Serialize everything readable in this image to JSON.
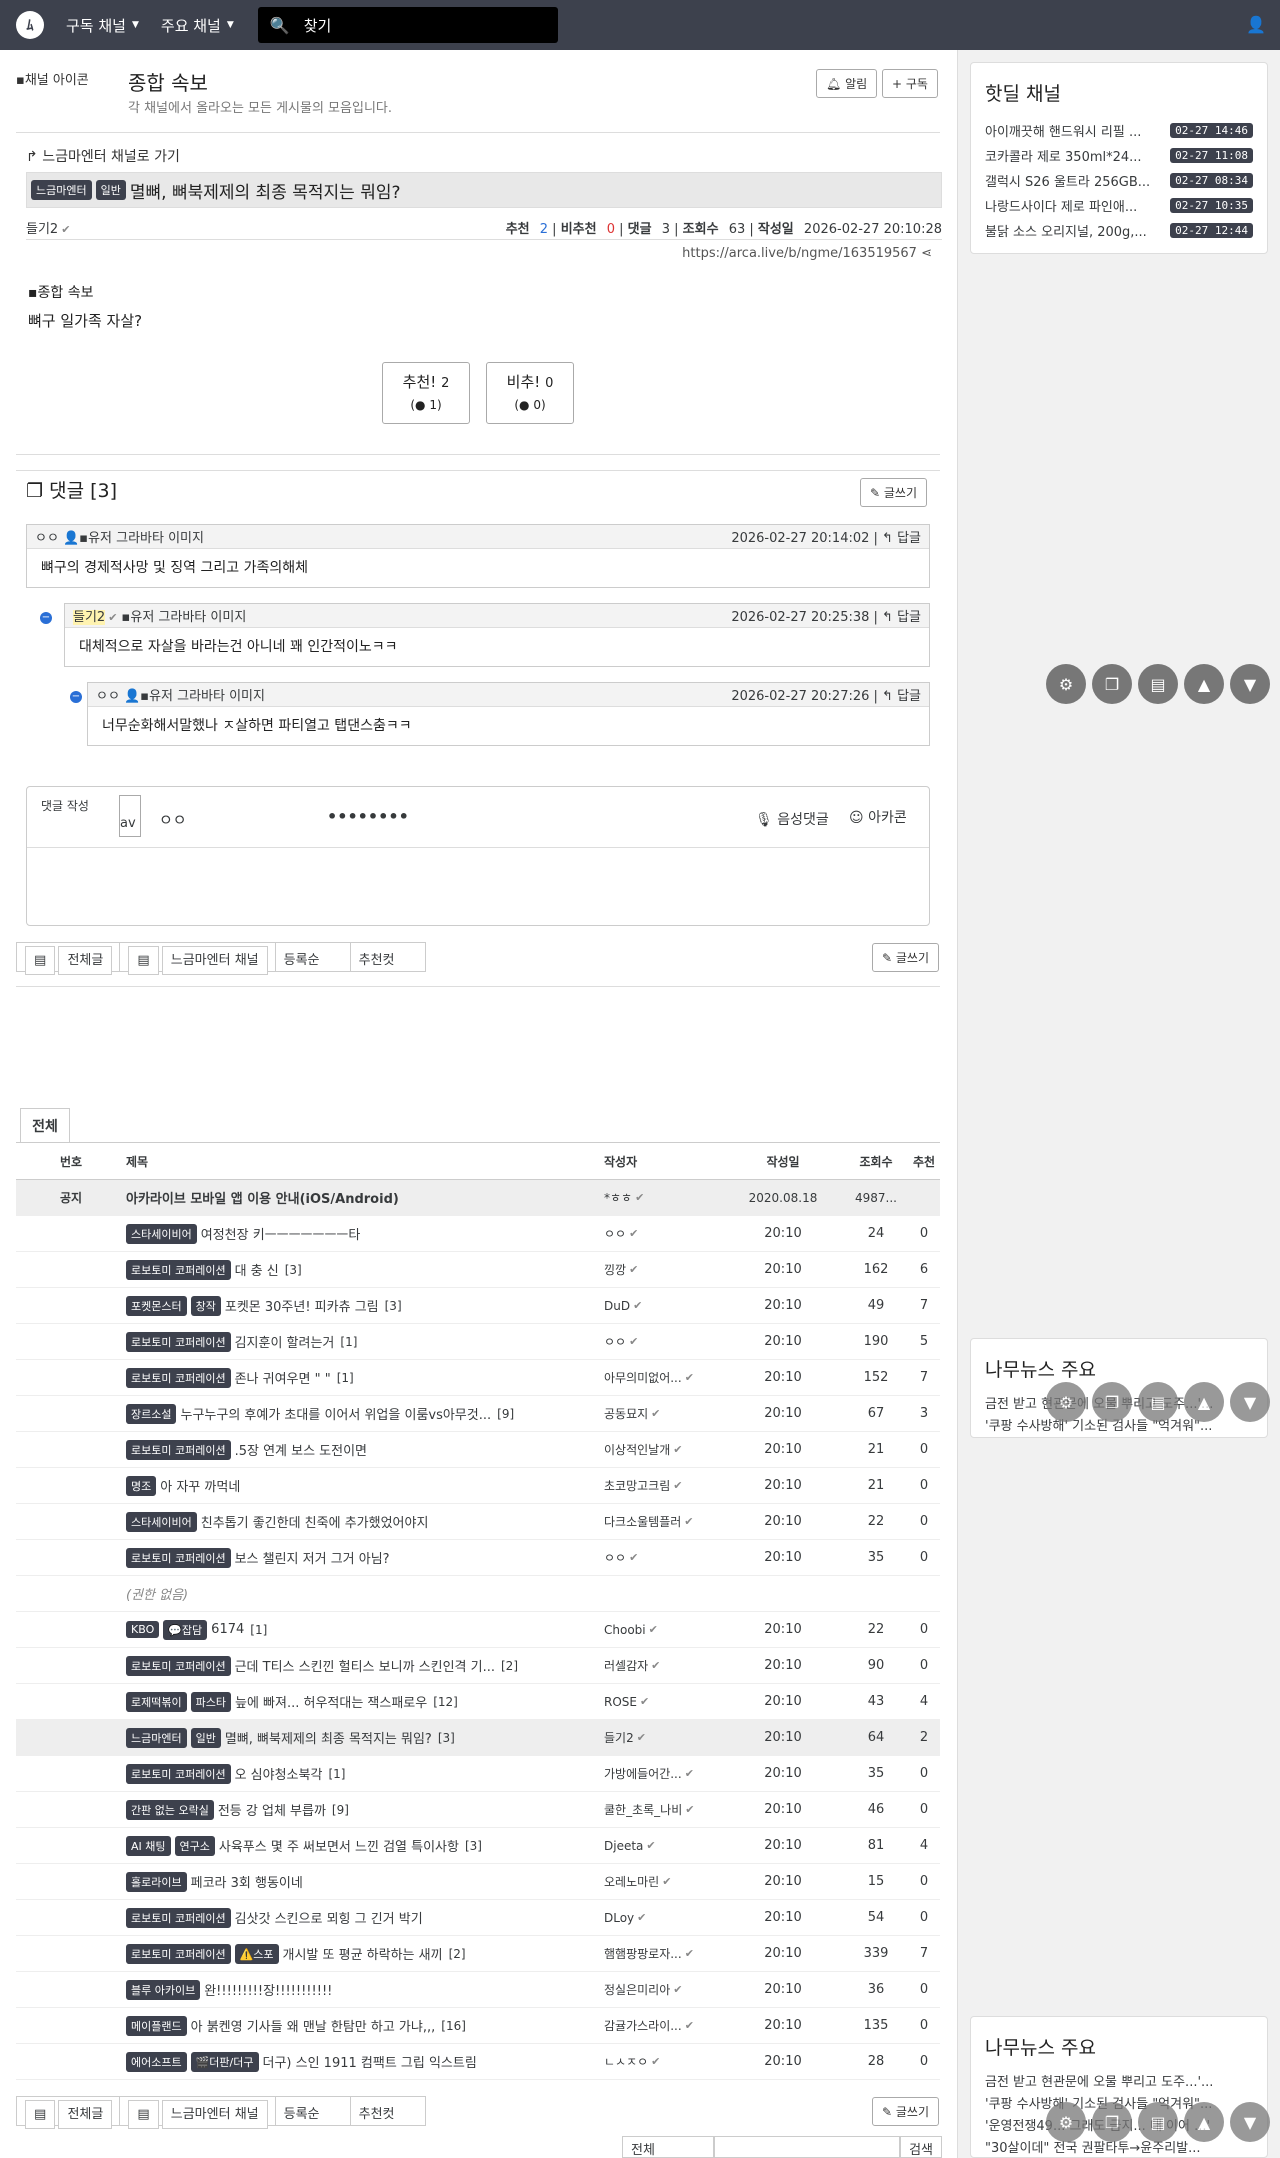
{
  "nav": {
    "logo": "ﾑ",
    "subscribed_label": "구독 채널",
    "main_label": "주요 채널",
    "search_placeholder": "찾기"
  },
  "channel": {
    "image_alt": "채널 아이콘",
    "title": "종합 속보",
    "desc": "각 채널에서 올라오는 모든 게시물의 모음입니다.",
    "alarm_label": "알림",
    "subscribe_label": "구독"
  },
  "article": {
    "goto_label": "느금마엔터 채널로 가기",
    "badge1": "느금마엔터",
    "badge2": "일반",
    "title": "멸뼈, 뼈북제제의 최종 목적지는 뭐임?",
    "author": "들기2",
    "rec_label": "추천",
    "rec": "2",
    "nrec_label": "비추천",
    "nrec": "0",
    "cmt_label": "댓글",
    "cmt": "3",
    "views_label": "조회수",
    "views": "63",
    "date_label": "작성일",
    "date": "2026-02-27 20:10:28",
    "url": "https://arca.live/b/ngme/163519567",
    "body_img_alt": "종합 속보",
    "body_text": "뼈구 일가족 자살?",
    "vote_up": "추천!",
    "vote_up_count": "2",
    "vote_up_sub": "1",
    "vote_down": "비추!",
    "vote_down_count": "0",
    "vote_down_sub": "0"
  },
  "comments": {
    "header": "댓글 [3]",
    "write_label": "글쓰기",
    "reply_label": "답글",
    "avatar_alt": "유저 그라바타 이미지",
    "items": [
      {
        "author": "ㅇㅇ",
        "date": "2026-02-27 20:14:02",
        "text": "뼈구의 경제적사망 및 징역 그리고 가족의해체"
      },
      {
        "author": "들기2",
        "date": "2026-02-27 20:25:38",
        "text": "대체적으로 자살을 바라는건 아니네 꽤 인간적이노ㅋㅋ"
      },
      {
        "author": "ㅇㅇ",
        "date": "2026-02-27 20:27:26",
        "text": "너무순화해서말했나 ㅈ살하면 파티열고 탭댄스춤ㅋㅋ"
      }
    ],
    "form_label": "댓글 작성",
    "form_avatar": "av",
    "form_name": "ㅇㅇ",
    "form_pw": "••••••••",
    "voice_label": "음성댓글",
    "arcacon_label": "아카콘"
  },
  "tabs": {
    "all": "전체글",
    "channel": "느금마엔터 채널",
    "order": "등록순",
    "recommend": "추천컷",
    "write": "글쓰기"
  },
  "list": {
    "tab": "전체",
    "headers": {
      "no": "번호",
      "title": "제목",
      "author": "작성자",
      "date": "작성일",
      "views": "조회수",
      "rec": "추천"
    },
    "notice": {
      "no": "공지",
      "title": "아카라이브 모바일 앱 이용 안내(iOS/Android)",
      "author": "*ㅎㅎ",
      "date": "2020.08.18",
      "views": "4987...",
      "rec": ""
    },
    "rows": [
      {
        "b1": "스타세이비어",
        "b2": "",
        "title": "여정천장 키ㅡㅡㅡㅡㅡㅡㅡ타",
        "cmt": "",
        "author": "ㅇㅇ",
        "date": "20:10",
        "views": "24",
        "rec": "0"
      },
      {
        "b1": "로보토미 코퍼레이션",
        "b2": "",
        "title": "대 충 신",
        "cmt": "[3]",
        "author": "낑깡",
        "date": "20:10",
        "views": "162",
        "rec": "6"
      },
      {
        "b1": "포켓몬스터",
        "b2": "창작",
        "title": "포켓몬 30주년! 피카츄 그림",
        "cmt": "[3]",
        "author": "DuD",
        "date": "20:10",
        "views": "49",
        "rec": "7"
      },
      {
        "b1": "로보토미 코퍼레이션",
        "b2": "",
        "title": "김지훈이 할려는거",
        "cmt": "[1]",
        "author": "ㅇㅇ",
        "date": "20:10",
        "views": "190",
        "rec": "5"
      },
      {
        "b1": "로보토미 코퍼레이션",
        "b2": "",
        "title": "존나 귀여우면 \" \"",
        "cmt": "[1]",
        "author": "아무의미없어...",
        "date": "20:10",
        "views": "152",
        "rec": "7"
      },
      {
        "b1": "장르소설",
        "b2": "",
        "title": "누구누구의 후예가 초대를 이어서 위업을 이룸vs아무것...",
        "cmt": "[9]",
        "author": "공동묘지",
        "date": "20:10",
        "views": "67",
        "rec": "3"
      },
      {
        "b1": "로보토미 코퍼레이션",
        "b2": "",
        "title": ".5장 연계 보스 도전이면",
        "cmt": "",
        "author": "이상적인날개",
        "date": "20:10",
        "views": "21",
        "rec": "0"
      },
      {
        "b1": "명조",
        "b2": "",
        "title": "아 자꾸 까먹네",
        "cmt": "",
        "author": "초코망고크림",
        "date": "20:10",
        "views": "21",
        "rec": "0"
      },
      {
        "b1": "스타세이비어",
        "b2": "",
        "title": "친추톱기 좋긴한데 친죽에 추가했었어야지",
        "cmt": "",
        "author": "다크소울템플러",
        "date": "20:10",
        "views": "22",
        "rec": "0"
      },
      {
        "b1": "로보토미 코퍼레이션",
        "b2": "",
        "title": "보스 챌린지 저거 그거 아님?",
        "cmt": "",
        "author": "ㅇㅇ",
        "date": "20:10",
        "views": "35",
        "rec": "0"
      },
      {
        "b1": "",
        "b2": "",
        "title": "(권한 없음)",
        "cmt": "",
        "author": "",
        "date": "",
        "views": "",
        "rec": ""
      },
      {
        "b1": "KBO",
        "b2": "💬잡담",
        "title": "6174",
        "cmt": "[1]",
        "author": "Choobi",
        "date": "20:10",
        "views": "22",
        "rec": "0"
      },
      {
        "b1": "로보토미 코퍼레이션",
        "b2": "",
        "title": "근데 T티스 스킨낀 헐티스 보니까 스킨인격 기...",
        "cmt": "[2]",
        "author": "러셀감자",
        "date": "20:10",
        "views": "90",
        "rec": "0"
      },
      {
        "b1": "로제떡볶이",
        "b2": "파스타",
        "title": "늪에 빠져... 허우적대는 잭스패로우",
        "cmt": "[12]",
        "author": "ROSE",
        "date": "20:10",
        "views": "43",
        "rec": "4"
      },
      {
        "b1": "느금마엔터",
        "b2": "일반",
        "title": "멸뼈, 뼈북제제의 최종 목적지는 뭐임?",
        "cmt": "[3]",
        "author": "들기2",
        "date": "20:10",
        "views": "64",
        "rec": "2"
      },
      {
        "b1": "로보토미 코퍼레이션",
        "b2": "",
        "title": "오 심야청소북각",
        "cmt": "[1]",
        "author": "가방에들어간...",
        "date": "20:10",
        "views": "35",
        "rec": "0"
      },
      {
        "b1": "간판 없는 오락실",
        "b2": "",
        "title": "전등 강 업체 부릅까",
        "cmt": "[9]",
        "author": "쿨한_초록_나비",
        "date": "20:10",
        "views": "46",
        "rec": "0"
      },
      {
        "b1": "AI 채팅",
        "b2": "연구소",
        "title": "사육푸스 몇 주 써보면서 느낀 검열 특이사항",
        "cmt": "[3]",
        "author": "Djeeta",
        "date": "20:10",
        "views": "81",
        "rec": "4"
      },
      {
        "b1": "홀로라이브",
        "b2": "",
        "title": "페코라 3회 행동이네",
        "cmt": "",
        "author": "오레노마린",
        "date": "20:10",
        "views": "15",
        "rec": "0"
      },
      {
        "b1": "로보토미 코퍼레이션",
        "b2": "",
        "title": "김삿갓 스킨으로 뫼힝 그 긴거 박기",
        "cmt": "",
        "author": "DLoy",
        "date": "20:10",
        "views": "54",
        "rec": "0"
      },
      {
        "b1": "로보토미 코퍼레이션",
        "b2": "⚠️스포",
        "title": "개시발 또 평균 하락하는 새끼",
        "cmt": "[2]",
        "author": "햄햄팡팡로자...",
        "date": "20:10",
        "views": "339",
        "rec": "7"
      },
      {
        "b1": "블루 아카이브",
        "b2": "",
        "title": "완!!!!!!!!!장!!!!!!!!!!!",
        "cmt": "",
        "author": "정실은미리아",
        "date": "20:10",
        "views": "36",
        "rec": "0"
      },
      {
        "b1": "메이플랜드",
        "b2": "",
        "title": "아 붉켄영 기사들 왜 맨날 한탐만 하고 가냐,,,",
        "cmt": "[16]",
        "author": "감귤가스라이...",
        "date": "20:10",
        "views": "135",
        "rec": "0"
      },
      {
        "b1": "에어소프트",
        "b2": "🎬더판/더구",
        "title": "더구) 스인 1911 컴팩트 그립 익스트림",
        "cmt": "",
        "author": "ㄴㅅㅈㅇ",
        "date": "20:10",
        "views": "28",
        "rec": "0"
      }
    ]
  },
  "footer_search": {
    "option": "전체",
    "button": "검색"
  },
  "hotdeal": {
    "title": "핫딜 채널",
    "items": [
      {
        "t": "아이깨끗해 핸드워시 리필 ...",
        "d": "02-27 14:46"
      },
      {
        "t": "코카콜라 제로 350ml*24...",
        "d": "02-27 11:08"
      },
      {
        "t": "갤럭시 S26 울트라 256GB...",
        "d": "02-27 08:34"
      },
      {
        "t": "나랑드사이다 제로 파인애...",
        "d": "02-27 10:35"
      },
      {
        "t": "불닭 소스 오리지널, 200g,...",
        "d": "02-27 12:44"
      }
    ]
  },
  "news": {
    "title": "나무뉴스 주요",
    "items": [
      "금전 받고 현관문에 오물 뿌리고 도주...'...",
      "'쿠팡 수사방해' 기소된 검사들 \"억겨워\"...",
      "'운영전쟁49... 그래도 금지... 대 이어 ...'",
      "\"30살이데\" 전국 권팔타투→윤주리발..."
    ]
  }
}
